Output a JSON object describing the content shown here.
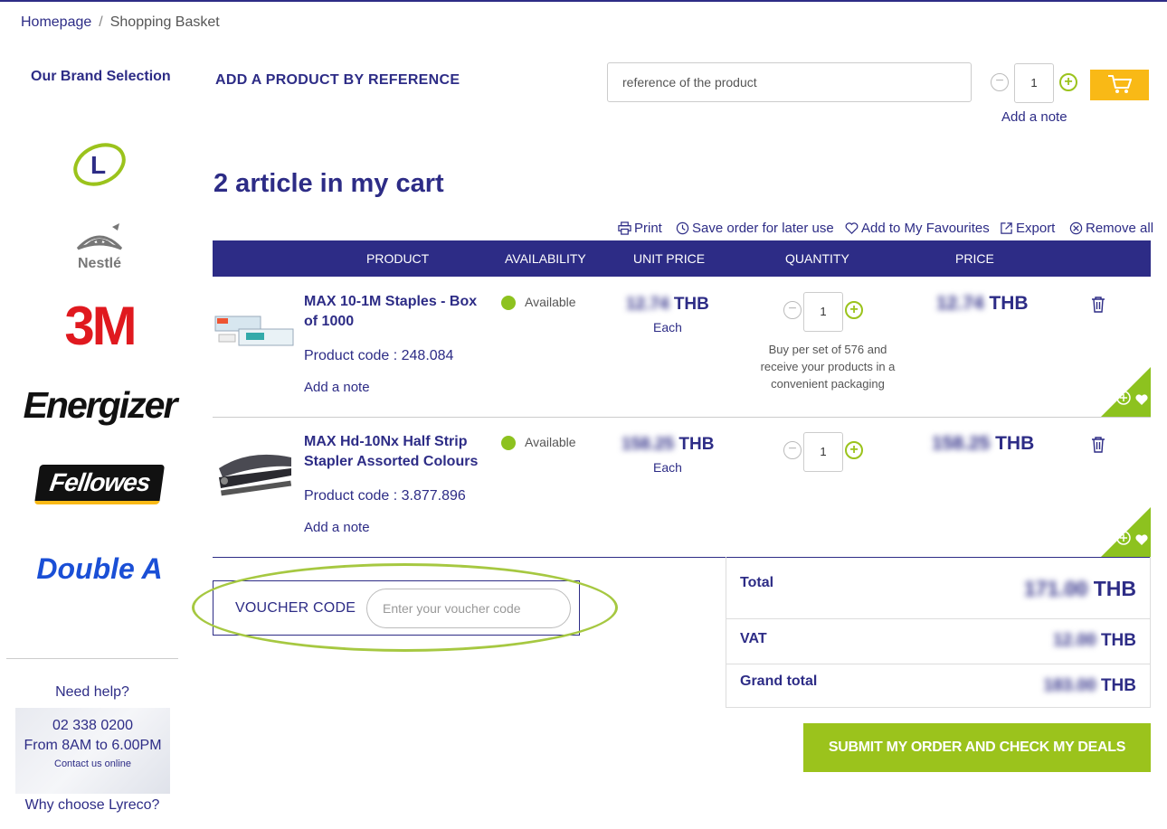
{
  "breadcrumb": {
    "home": "Homepage",
    "separator": "/",
    "current": "Shopping Basket"
  },
  "sidebar": {
    "title": "Our Brand Selection",
    "brands": [
      "L",
      "Nestlé",
      "3M",
      "Energizer",
      "Fellowes",
      "Double A"
    ],
    "help": {
      "title": "Need help?",
      "phone": "02 338 0200",
      "hours": "From 8AM to 6.00PM",
      "contact": "Contact us online",
      "why": "Why choose Lyreco?"
    }
  },
  "add_by_reference": {
    "title": "ADD A PRODUCT BY REFERENCE",
    "placeholder": "reference of the product",
    "quantity": "1",
    "add_note": "Add a note"
  },
  "cart": {
    "title": "2 article in my cart",
    "actions": {
      "print": "Print",
      "save": "Save order for later use",
      "favourites": "Add to My Favourites",
      "export": "Export",
      "remove_all": "Remove all"
    },
    "columns": {
      "product": "PRODUCT",
      "availability": "AVAILABILITY",
      "unit_price": "UNIT PRICE",
      "quantity": "QUANTITY",
      "price": "PRICE"
    },
    "items": [
      {
        "name": "MAX 10-1M Staples - Box of 1000",
        "code": "Product code : 248.084",
        "add_note": "Add a note",
        "availability": "Available",
        "unit_price": "12.74",
        "currency": "THB",
        "each": "Each",
        "quantity": "1",
        "pack_note": "Buy per set of 576 and receive your products in a convenient packaging",
        "price": "12.74"
      },
      {
        "name": "MAX Hd-10Nx Half Strip Stapler Assorted Colours",
        "code": "Product code : 3.877.896",
        "add_note": "Add a note",
        "availability": "Available",
        "unit_price": "158.25",
        "currency": "THB",
        "each": "Each",
        "quantity": "1",
        "pack_note": "",
        "price": "158.25"
      }
    ]
  },
  "voucher": {
    "label": "VOUCHER CODE",
    "placeholder": "Enter your voucher code"
  },
  "totals": {
    "total_label": "Total",
    "total_value": "171.00",
    "vat_label": "VAT",
    "vat_value": "12.00",
    "grand_label": "Grand total",
    "grand_value": "183.00",
    "currency": "THB"
  },
  "submit_label": "SUBMIT MY ORDER AND CHECK MY DEALS",
  "colors": {
    "navy": "#2d2c86",
    "green": "#9bc31c",
    "yellow": "#f9b916"
  }
}
